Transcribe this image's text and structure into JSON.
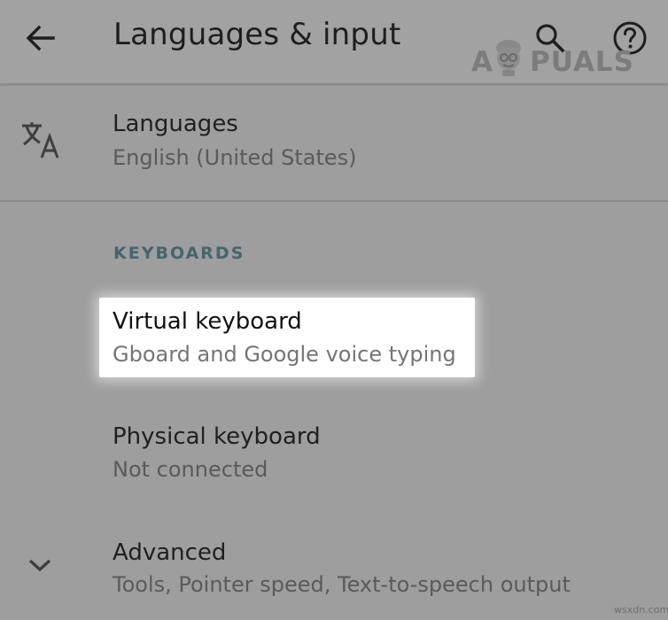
{
  "appbar": {
    "title": "Languages & input",
    "back_icon": "arrow-back-icon",
    "search_icon": "search-icon",
    "help_icon": "help-circle-icon"
  },
  "watermark": {
    "first_letter": "A",
    "rest": "PUALS"
  },
  "languages": {
    "icon": "translate-icon",
    "title": "Languages",
    "subtitle": "English (United States)"
  },
  "keyboards": {
    "header": "KEYBOARDS",
    "virtual": {
      "title": "Virtual keyboard",
      "subtitle": "Gboard and Google voice typing",
      "highlighted": true
    },
    "physical": {
      "title": "Physical keyboard",
      "subtitle": "Not connected"
    }
  },
  "advanced": {
    "icon": "chevron-down-icon",
    "title": "Advanced",
    "subtitle": "Tools, Pointer speed, Text-to-speech output"
  },
  "footer": {
    "site": "wsxdn.com"
  },
  "colors": {
    "background": "#9e9e9e",
    "appbar": "#a2a2a2",
    "section_header": "#45656e",
    "highlight": "#ffffff"
  }
}
